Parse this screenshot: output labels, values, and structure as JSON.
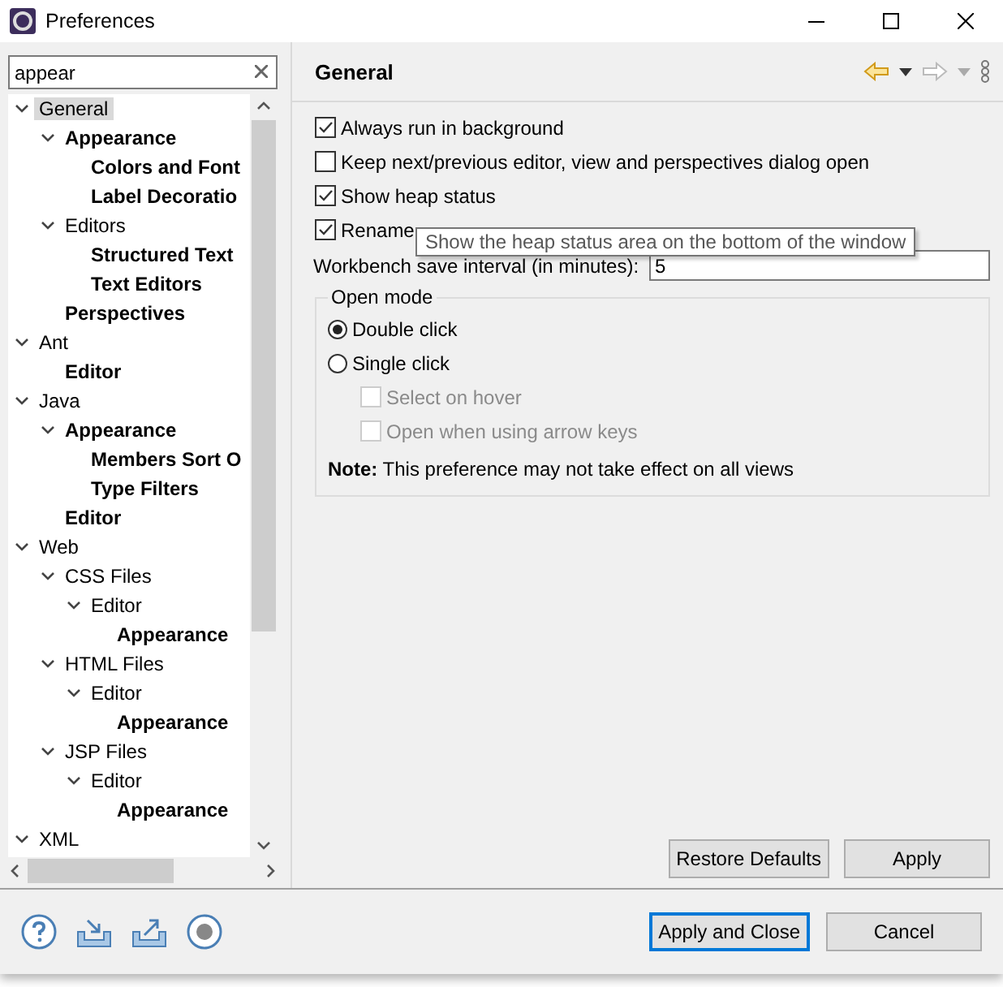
{
  "window": {
    "title": "Preferences"
  },
  "filter": {
    "value": "appear"
  },
  "tree": [
    {
      "label": "General",
      "selected": true,
      "matched": false,
      "expanded": true,
      "children": [
        {
          "label": "Appearance",
          "selected": false,
          "matched": true,
          "expanded": true,
          "children": [
            {
              "label": "Colors and Font",
              "selected": false,
              "matched": true
            },
            {
              "label": "Label Decoratio",
              "selected": false,
              "matched": true
            }
          ]
        },
        {
          "label": "Editors",
          "selected": false,
          "matched": false,
          "expanded": true,
          "children": [
            {
              "label": "Structured Text",
              "selected": false,
              "matched": true
            },
            {
              "label": "Text Editors",
              "selected": false,
              "matched": true
            }
          ]
        },
        {
          "label": "Perspectives",
          "selected": false,
          "matched": true
        }
      ]
    },
    {
      "label": "Ant",
      "selected": false,
      "matched": false,
      "expanded": true,
      "children": [
        {
          "label": "Editor",
          "selected": false,
          "matched": true
        }
      ]
    },
    {
      "label": "Java",
      "selected": false,
      "matched": false,
      "expanded": true,
      "children": [
        {
          "label": "Appearance",
          "selected": false,
          "matched": true,
          "expanded": true,
          "children": [
            {
              "label": "Members Sort O",
              "selected": false,
              "matched": true
            },
            {
              "label": "Type Filters",
              "selected": false,
              "matched": true
            }
          ]
        },
        {
          "label": "Editor",
          "selected": false,
          "matched": true
        }
      ]
    },
    {
      "label": "Web",
      "selected": false,
      "matched": false,
      "expanded": true,
      "children": [
        {
          "label": "CSS Files",
          "selected": false,
          "matched": false,
          "expanded": true,
          "children": [
            {
              "label": "Editor",
              "selected": false,
              "matched": false,
              "expanded": true,
              "children": [
                {
                  "label": "Appearance",
                  "selected": false,
                  "matched": true
                }
              ]
            }
          ]
        },
        {
          "label": "HTML Files",
          "selected": false,
          "matched": false,
          "expanded": true,
          "children": [
            {
              "label": "Editor",
              "selected": false,
              "matched": false,
              "expanded": true,
              "children": [
                {
                  "label": "Appearance",
                  "selected": false,
                  "matched": true
                }
              ]
            }
          ]
        },
        {
          "label": "JSP Files",
          "selected": false,
          "matched": false,
          "expanded": true,
          "children": [
            {
              "label": "Editor",
              "selected": false,
              "matched": false,
              "expanded": true,
              "children": [
                {
                  "label": "Appearance",
                  "selected": false,
                  "matched": true
                }
              ]
            }
          ]
        }
      ]
    },
    {
      "label": "XML",
      "selected": false,
      "matched": false,
      "expanded": true
    }
  ],
  "page": {
    "title": "General",
    "options": [
      {
        "label": "Always run in background",
        "checked": true
      },
      {
        "label": "Keep next/previous editor, view and perspectives dialog open",
        "checked": false
      },
      {
        "label": "Show heap status",
        "checked": true
      },
      {
        "label": "Rename",
        "checked": true
      }
    ],
    "tooltip": "Show the heap status area on the bottom of the window",
    "save_interval": {
      "label": "Workbench save interval (in minutes):",
      "value": "5"
    },
    "open_mode": {
      "title": "Open mode",
      "radios": [
        {
          "label": "Double click",
          "selected": true
        },
        {
          "label": "Single click",
          "selected": false
        }
      ],
      "sub_options": [
        {
          "label": "Select on hover",
          "checked": false,
          "disabled": true
        },
        {
          "label": "Open when using arrow keys",
          "checked": false,
          "disabled": true
        }
      ],
      "note": "**Note:** This preference may not take effect on all views"
    },
    "buttons": [
      "Restore Defaults",
      "Apply"
    ]
  },
  "footer_buttons": [
    {
      "label": "Apply and Close",
      "default": true
    },
    {
      "label": "Cancel",
      "default": false
    }
  ]
}
